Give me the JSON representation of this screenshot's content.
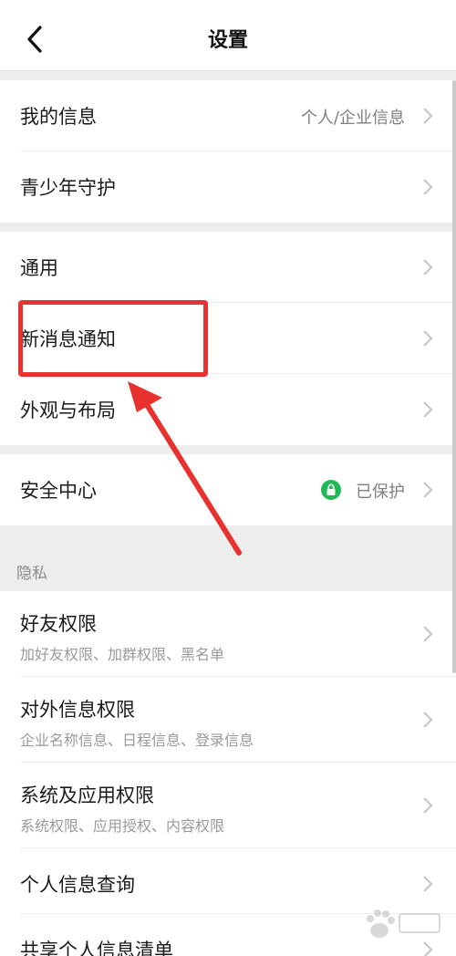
{
  "header": {
    "title": "设置"
  },
  "groups": [
    {
      "items": [
        {
          "label": "我的信息",
          "value": "个人/企业信息"
        },
        {
          "label": "青少年守护"
        }
      ]
    },
    {
      "items": [
        {
          "label": "通用"
        },
        {
          "label": "新消息通知"
        },
        {
          "label": "外观与布局"
        }
      ]
    },
    {
      "items": [
        {
          "label": "安全中心",
          "value": "已保护"
        }
      ]
    }
  ],
  "privacy": {
    "section_label": "隐私",
    "items": [
      {
        "label": "好友权限",
        "sub": "加好友权限、加群权限、黑名单"
      },
      {
        "label": "对外信息权限",
        "sub": "企业名称信息、日程信息、登录信息"
      },
      {
        "label": "系统及应用权限",
        "sub": "系统权限、应用授权、内容权限"
      },
      {
        "label": "个人信息查询"
      },
      {
        "label": "共享个人信息清单"
      }
    ]
  },
  "colors": {
    "accent_red": "#e8322f",
    "lock_green": "#1fb955",
    "chevron": "#c4c4c4"
  },
  "icons": {
    "back": "chevron-left-icon",
    "row": "chevron-right-icon",
    "lock": "lock-icon",
    "watermark": "baidu-paw-icon"
  }
}
